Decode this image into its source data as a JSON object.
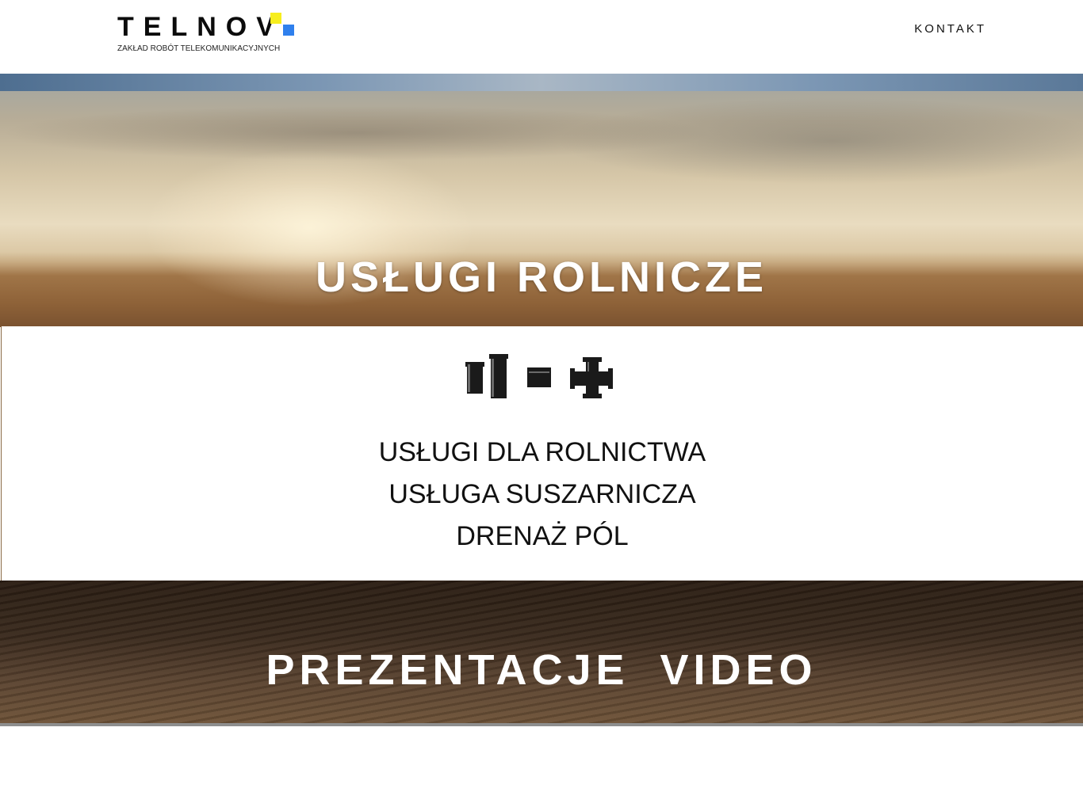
{
  "header": {
    "logo_text": "TELNOV",
    "tagline": "ZAKŁAD ROBÓT TELEKOMUNIKACYJNYCH",
    "nav": {
      "contact": "KONTAKT"
    },
    "brand_colors": {
      "yellow": "#f7ee1d",
      "blue": "#2f80ed"
    }
  },
  "hero": {
    "title": "USŁUGI ROLNICZE"
  },
  "services": {
    "icons": [
      "pipe-fittings-icon",
      "pipe-connector-icon",
      "cross-fitting-icon"
    ],
    "items": [
      {
        "label": "USŁUGI DLA ROLNICTWA"
      },
      {
        "label": "USŁUGA SUSZARNICZA"
      },
      {
        "label": "DRENAŻ PÓL"
      }
    ]
  },
  "video": {
    "title": "PREZENTACJE VIDEO"
  }
}
